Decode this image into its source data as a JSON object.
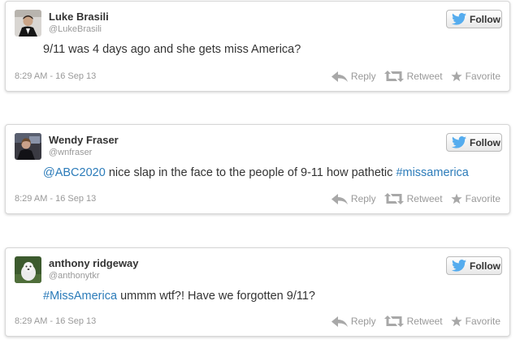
{
  "follow_label": "Follow",
  "action_labels": {
    "reply": "Reply",
    "retweet": "Retweet",
    "favorite": "Favorite"
  },
  "colors": {
    "link": "#2b7bb9",
    "twitter_bird": "#55acee",
    "action_gray": "#999999"
  },
  "tweets": [
    {
      "name": "Luke Brasili",
      "handle": "@LukeBrasili",
      "text_plain": "9/11 was 4 days ago and she gets miss America?",
      "timestamp": "8:29 AM - 16 Sep 13"
    },
    {
      "name": "Wendy Fraser",
      "handle": "@wnfraser",
      "mention": "@ABC2020",
      "text_middle": " nice slap in the face to the people of 9-11 how pathetic ",
      "hashtag": "#missamerica",
      "timestamp": "8:29 AM - 16 Sep 13"
    },
    {
      "name": "anthony ridgeway",
      "handle": "@anthonytkr",
      "hashtag": "#MissAmerica",
      "text_rest": " ummm wtf?! Have we forgotten 9/11?",
      "timestamp": "8:29 AM - 16 Sep 13"
    }
  ]
}
